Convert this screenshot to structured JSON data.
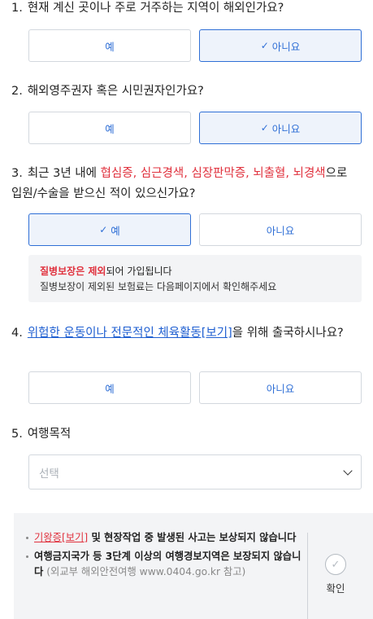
{
  "q1": {
    "num": "1.",
    "text": "현재 계신 곳이나 주로 거주하는 지역이 해외인가요?",
    "yes": "예",
    "no": "아니요",
    "selected": "no"
  },
  "q2": {
    "num": "2.",
    "text": "해외영주권자 혹은 시민권자인가요?",
    "yes": "예",
    "no": "아니요",
    "selected": "no"
  },
  "q3": {
    "num": "3.",
    "prefix": "최근 3년 내에 ",
    "d1": "협심증",
    "sep1": ", ",
    "d2": "심근경색",
    "sep2": ", ",
    "d3": "심장판막증",
    "sep3": ", ",
    "d4": "뇌출혈",
    "sep4": ", ",
    "d5": "뇌경색",
    "suffix": "으로 입원/수술을 받으신 적이 있으신가요?",
    "yes": "예",
    "no": "아니요",
    "selected": "yes",
    "notice_strong": "질병보장은 제외",
    "notice_rest": "되어 가입됩니다",
    "notice_line2": "질병보장이 제외된 보험료는 다음페이지에서 확인해주세요"
  },
  "q4": {
    "num": "4.",
    "link": "위험한 운동이나 전문적인 체육활동[보기]",
    "suffix": "을 위해 출국하시나요?",
    "yes": "예",
    "no": "아니요"
  },
  "q5": {
    "num": "5.",
    "text": "여행목적",
    "placeholder": "선택"
  },
  "footer": {
    "b1_link": "기왕증[보기]",
    "b1_text": " 및 현장작업 중 발생된 사고는 보상되지 않습니다",
    "b2_text": "여행금지국가 등 3단계 이상의 여행경보지역은 보장되지 않습니다",
    "b2_gray": " (외교부 해외안전여행 www.0404.go.kr 참고)",
    "confirm_label": "확인"
  },
  "colors": {
    "accent": "#2f6fd6",
    "warning": "#e0313d",
    "link": "#1f5fd1"
  },
  "icons": {
    "check": "check-icon",
    "chevron": "chevron-down-icon",
    "confirm": "check-circle-icon"
  }
}
